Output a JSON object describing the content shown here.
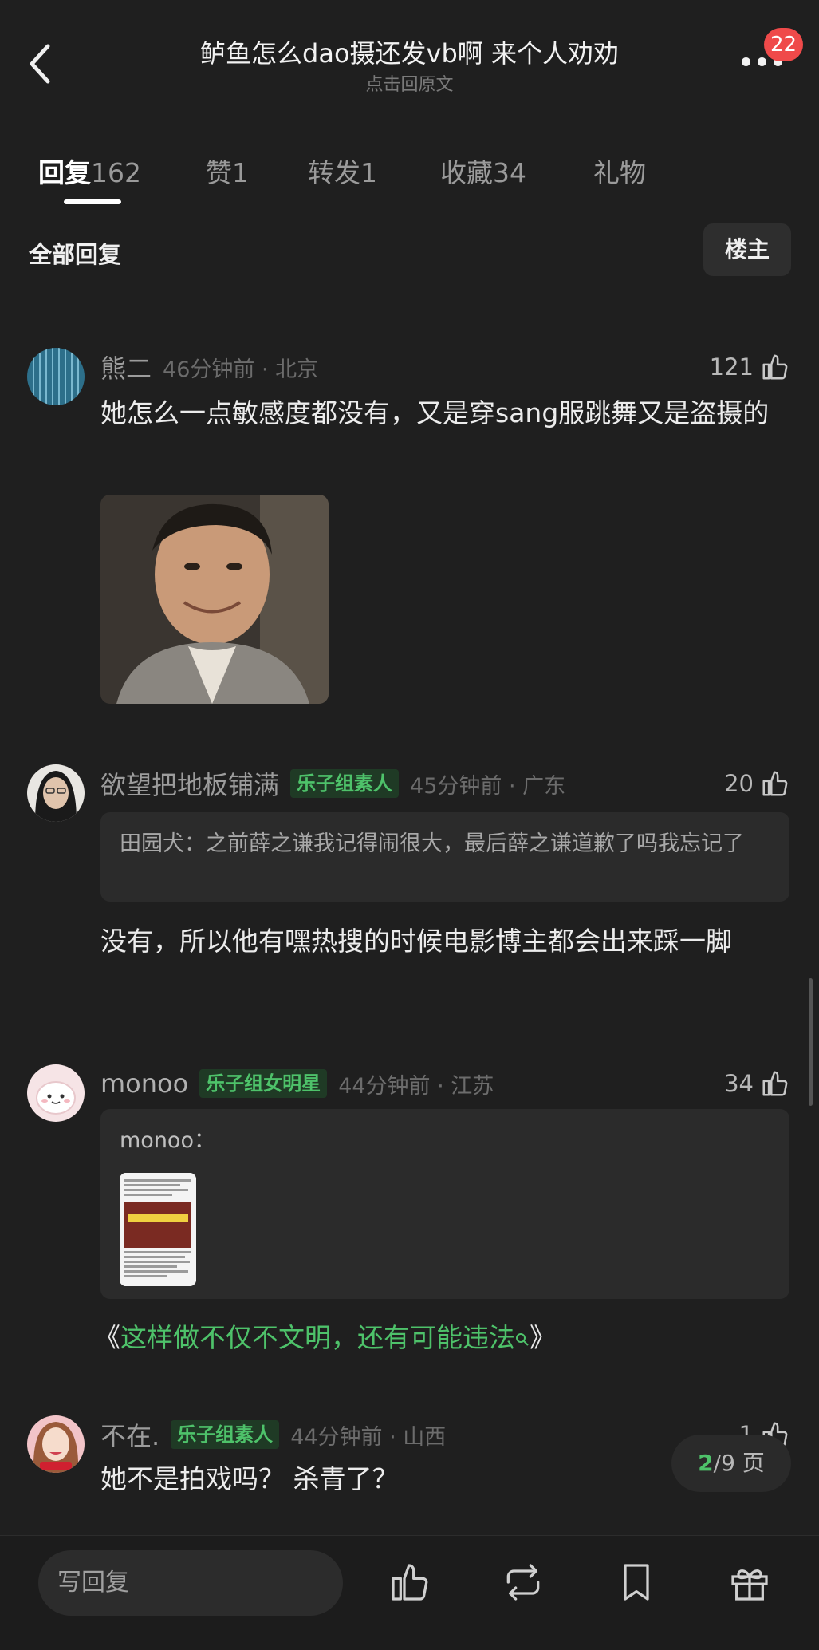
{
  "header": {
    "title": "鲈鱼怎么dao摄还发vb啊 来个人劝劝",
    "subtitle": "点击回原文",
    "badge": "22"
  },
  "tabs": [
    {
      "label": "回复",
      "count": "162"
    },
    {
      "label": "赞",
      "count": "1"
    },
    {
      "label": "转发",
      "count": "1"
    },
    {
      "label": "收藏",
      "count": "34"
    },
    {
      "label": "礼物",
      "count": ""
    }
  ],
  "filter": {
    "label": "全部回复",
    "owner_button": "楼主"
  },
  "comments": [
    {
      "username": "熊二",
      "tag": "",
      "time": "46分钟前 · 北京",
      "likes": "121",
      "text": "她怎么一点敏感度都没有，又是穿sang服跳舞又是盗摄的"
    },
    {
      "username": "欲望把地板铺满",
      "tag": "乐子组素人",
      "time": "45分钟前 · 广东",
      "likes": "20",
      "quote": "田园犬：之前薛之谦我记得闹很大，最后薛之谦道歉了吗我忘记了",
      "text": "没有，所以他有嘿热搜的时候电影博主都会出来踩一脚"
    },
    {
      "username": "monoo",
      "tag": "乐子组女明星",
      "time": "44分钟前 · 江苏",
      "likes": "34",
      "quote_author": "monoo：",
      "link_open": "《",
      "link_text": "这样做不仅不文明，还有可能违法",
      "link_close": "》"
    },
    {
      "username": "不在.",
      "tag": "乐子组素人",
      "time": "44分钟前 · 山西",
      "likes": "1",
      "text": "她不是拍戏吗？ 杀青了？"
    }
  ],
  "pagination": {
    "current": "2",
    "total": "/9",
    "unit": "页"
  },
  "bottom_bar": {
    "reply_placeholder": "写回复"
  }
}
